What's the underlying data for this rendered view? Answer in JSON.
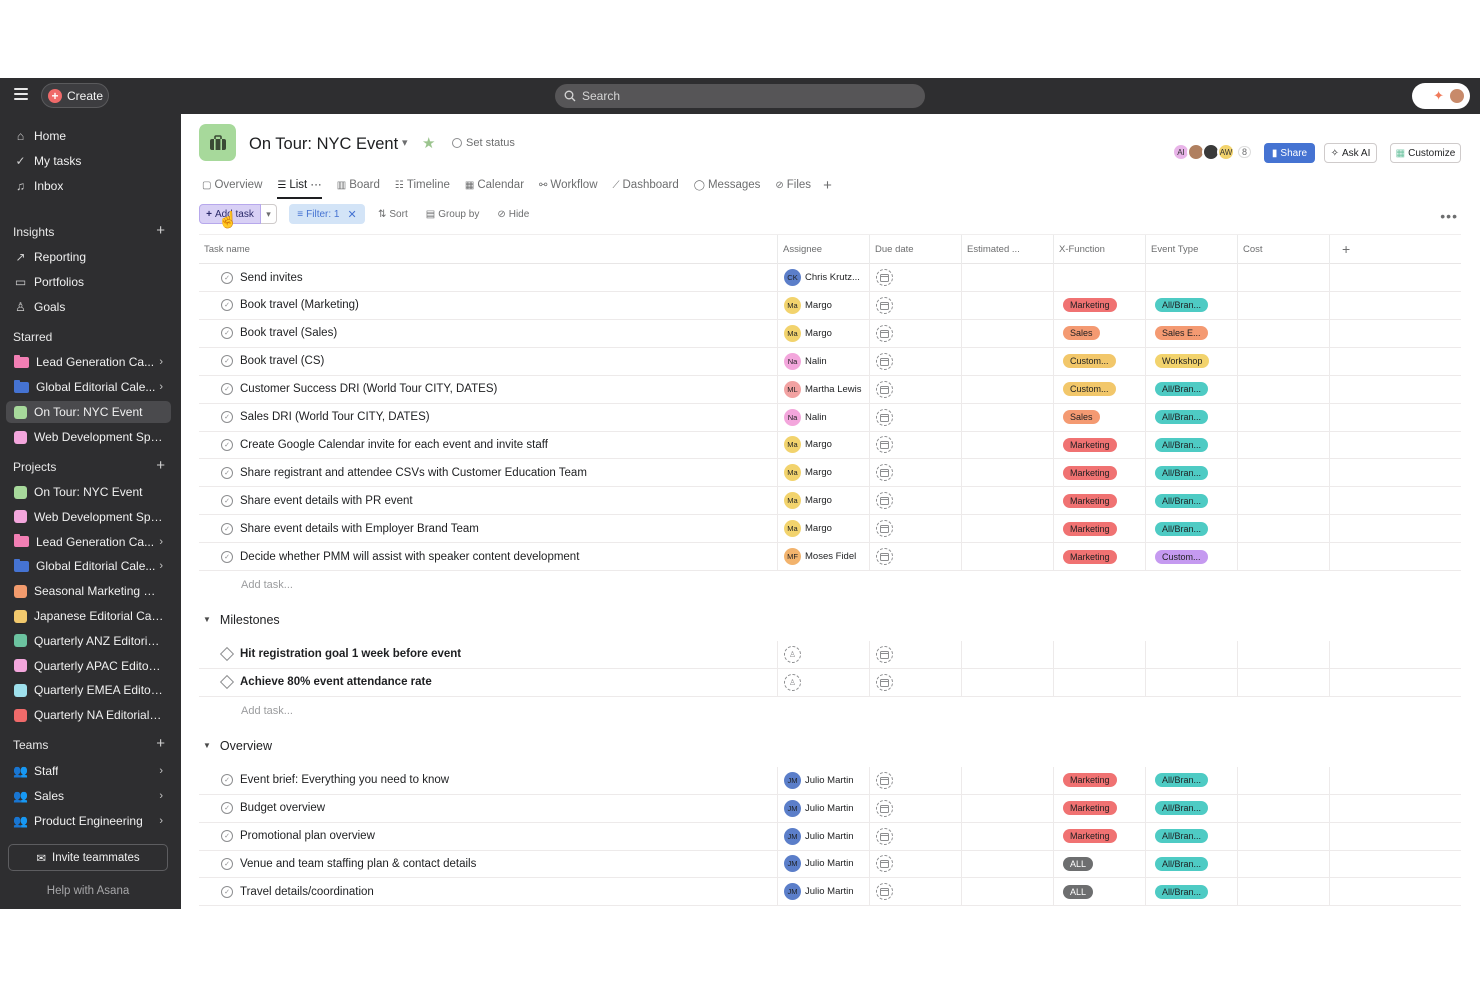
{
  "topbar": {
    "create_label": "Create",
    "search_placeholder": "Search"
  },
  "sidebar": {
    "nav": [
      {
        "label": "Home",
        "icon": "home-icon"
      },
      {
        "label": "My tasks",
        "icon": "check-circle-icon"
      },
      {
        "label": "Inbox",
        "icon": "bell-icon"
      }
    ],
    "insights_label": "Insights",
    "insights": [
      {
        "label": "Reporting",
        "icon": "chart-line-icon"
      },
      {
        "label": "Portfolios",
        "icon": "folder-icon"
      },
      {
        "label": "Goals",
        "icon": "person-icon"
      }
    ],
    "starred_label": "Starred",
    "starred": [
      {
        "label": "Lead Generation Ca...",
        "color": "#f27fb4",
        "kind": "folder",
        "chevron": true
      },
      {
        "label": "Global Editorial Cale...",
        "color": "#4573d2",
        "kind": "folder",
        "chevron": true
      },
      {
        "label": "On Tour: NYC Event",
        "color": "#a7d99b",
        "kind": "square",
        "chevron": false
      },
      {
        "label": "Web Development Sprint...",
        "color": "#f3a6dc",
        "kind": "square",
        "chevron": false
      }
    ],
    "projects_label": "Projects",
    "projects": [
      {
        "label": "On Tour: NYC Event",
        "color": "#a7d99b",
        "kind": "square",
        "chevron": false
      },
      {
        "label": "Web Development Sprint...",
        "color": "#f3a6dc",
        "kind": "square",
        "chevron": false
      },
      {
        "label": "Lead Generation Ca...",
        "color": "#f27fb4",
        "kind": "folder",
        "chevron": true
      },
      {
        "label": "Global Editorial Cale...",
        "color": "#4573d2",
        "kind": "folder",
        "chevron": true
      },
      {
        "label": "Seasonal Marketing Cam...",
        "color": "#f29b6d",
        "kind": "square",
        "chevron": false
      },
      {
        "label": "Japanese Editorial Calen...",
        "color": "#f2c96d",
        "kind": "square",
        "chevron": false
      },
      {
        "label": "Quarterly ANZ Editorial C...",
        "color": "#6cc3a0",
        "kind": "square",
        "chevron": false
      },
      {
        "label": "Quarterly APAC Editorial ...",
        "color": "#f3a6dc",
        "kind": "square",
        "chevron": false
      },
      {
        "label": "Quarterly EMEA Editorial...",
        "color": "#9ee0ec",
        "kind": "square",
        "chevron": false
      },
      {
        "label": "Quarterly NA Editorial Ca...",
        "color": "#f06a6a",
        "kind": "square",
        "chevron": false
      }
    ],
    "teams_label": "Teams",
    "teams": [
      {
        "label": "Staff"
      },
      {
        "label": "Sales"
      },
      {
        "label": "Product Engineering"
      }
    ],
    "invite_label": "Invite teammates",
    "help_label": "Help with Asana"
  },
  "header": {
    "title": "On Tour: NYC Event",
    "set_status": "Set status",
    "avatars": [
      {
        "initials": "AI",
        "color": "#e8b4e8"
      },
      {
        "initials": "",
        "color": "#b08060"
      },
      {
        "initials": "",
        "color": "#3a3a3a"
      },
      {
        "initials": "AW",
        "color": "#f2d36d"
      }
    ],
    "member_count": "8",
    "share_label": "Share",
    "askai_label": "Ask AI",
    "customize_label": "Customize"
  },
  "tabs": [
    {
      "label": "Overview",
      "icon": "overview-icon",
      "active": false
    },
    {
      "label": "List",
      "icon": "list-icon",
      "active": true
    },
    {
      "label": "Board",
      "icon": "board-icon",
      "active": false
    },
    {
      "label": "Timeline",
      "icon": "timeline-icon",
      "active": false
    },
    {
      "label": "Calendar",
      "icon": "calendar-icon",
      "active": false
    },
    {
      "label": "Workflow",
      "icon": "workflow-icon",
      "active": false
    },
    {
      "label": "Dashboard",
      "icon": "dashboard-icon",
      "active": false
    },
    {
      "label": "Messages",
      "icon": "messages-icon",
      "active": false
    },
    {
      "label": "Files",
      "icon": "paperclip-icon",
      "active": false
    }
  ],
  "toolbar": {
    "add_task": "Add task",
    "filter": "Filter: 1",
    "sort": "Sort",
    "group_by": "Group by",
    "hide": "Hide"
  },
  "columns": [
    "Task name",
    "Assignee",
    "Due date",
    "Estimated ...",
    "X-Function",
    "Event Type",
    "Cost"
  ],
  "colors": {
    "Marketing": "#f07272",
    "Sales": "#f49a72",
    "Custom...": "#f2c76a",
    "ALL": "#6d6e6f",
    "AllBrand": "#4ecbc4",
    "SalesE": "#f49a72",
    "Workshop": "#f2d36d",
    "CustomET": "#c59af0"
  },
  "sections": [
    {
      "title": "",
      "tasks": [
        {
          "name": "Send invites",
          "assignee": "Chris Krutz...",
          "initials": "CK",
          "av_color": "#5b7ec9",
          "xf": "",
          "et": ""
        },
        {
          "name": "Book travel (Marketing)",
          "assignee": "Margo",
          "initials": "Ma",
          "av_color": "#f2d36d",
          "xf": "Marketing",
          "et": "All/Bran..."
        },
        {
          "name": "Book travel (Sales)",
          "assignee": "Margo",
          "initials": "Ma",
          "av_color": "#f2d36d",
          "xf": "Sales",
          "et": "Sales E..."
        },
        {
          "name": "Book travel (CS)",
          "assignee": "Nalin",
          "initials": "Na",
          "av_color": "#f3a6dc",
          "xf": "Custom...",
          "et": "Workshop"
        },
        {
          "name": "Customer Success DRI (World Tour CITY, DATES)",
          "assignee": "Martha Lewis",
          "initials": "ML",
          "av_color": "#f2a2a2",
          "xf": "Custom...",
          "et": "All/Bran..."
        },
        {
          "name": "Sales DRI (World Tour CITY, DATES)",
          "assignee": "Nalin",
          "initials": "Na",
          "av_color": "#f3a6dc",
          "xf": "Sales",
          "et": "All/Bran..."
        },
        {
          "name": "Create Google Calendar invite for each event and invite staff",
          "assignee": "Margo",
          "initials": "Ma",
          "av_color": "#f2d36d",
          "xf": "Marketing",
          "et": "All/Bran..."
        },
        {
          "name": "Share registrant and attendee CSVs with Customer Education Team",
          "assignee": "Margo",
          "initials": "Ma",
          "av_color": "#f2d36d",
          "xf": "Marketing",
          "et": "All/Bran..."
        },
        {
          "name": "Share event details with PR event",
          "assignee": "Margo",
          "initials": "Ma",
          "av_color": "#f2d36d",
          "xf": "Marketing",
          "et": "All/Bran..."
        },
        {
          "name": "Share event details with Employer Brand Team",
          "assignee": "Margo",
          "initials": "Ma",
          "av_color": "#f2d36d",
          "xf": "Marketing",
          "et": "All/Bran..."
        },
        {
          "name": "Decide whether PMM will assist with speaker content development",
          "assignee": "Moses Fidel",
          "initials": "MF",
          "av_color": "#f2b36d",
          "xf": "Marketing",
          "et": "Custom..."
        }
      ],
      "add_task": "Add task..."
    },
    {
      "title": "Milestones",
      "tasks": [
        {
          "name": "Hit registration goal 1 week before event",
          "assignee": "",
          "milestone": true
        },
        {
          "name": "Achieve 80% event attendance rate",
          "assignee": "",
          "milestone": true
        }
      ],
      "add_task": "Add task..."
    },
    {
      "title": "Overview",
      "tasks": [
        {
          "name": "Event brief: Everything you need to know",
          "assignee": "Julio Martin",
          "initials": "JM",
          "av_color": "#5b7ec9",
          "xf": "Marketing",
          "et": "All/Bran..."
        },
        {
          "name": "Budget overview",
          "assignee": "Julio Martin",
          "initials": "JM",
          "av_color": "#5b7ec9",
          "xf": "Marketing",
          "et": "All/Bran..."
        },
        {
          "name": "Promotional plan overview",
          "assignee": "Julio Martin",
          "initials": "JM",
          "av_color": "#5b7ec9",
          "xf": "Marketing",
          "et": "All/Bran..."
        },
        {
          "name": "Venue and team staffing plan & contact details",
          "assignee": "Julio Martin",
          "initials": "JM",
          "av_color": "#5b7ec9",
          "xf": "ALL",
          "et": "All/Bran..."
        },
        {
          "name": "Travel details/coordination",
          "assignee": "Julio Martin",
          "initials": "JM",
          "av_color": "#5b7ec9",
          "xf": "ALL",
          "et": "All/Bran..."
        }
      ]
    }
  ]
}
